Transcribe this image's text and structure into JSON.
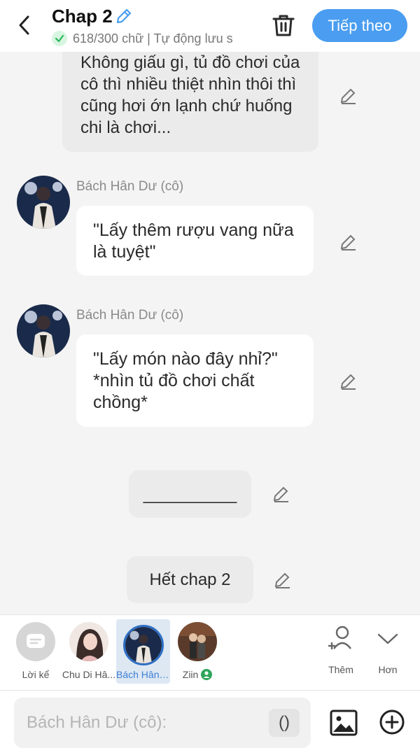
{
  "header": {
    "title": "Chap 2",
    "word_status": "618/300 chữ | Tự động lưu s",
    "next_label": "Tiếp theo",
    "accent_color": "#4a9df0"
  },
  "messages": [
    {
      "type": "narration",
      "text": "Không giấu gì, tủ đồ chơi của cô thì nhiều thiệt nhìn thôi thì cũng hơi ớn lạnh chứ huống chi là chơi..."
    },
    {
      "type": "dialogue",
      "speaker": "Bách Hân Dư (cô)",
      "text": "\"Lấy thêm rượu vang nữa là tuyệt\""
    },
    {
      "type": "dialogue",
      "speaker": "Bách Hân Dư (cô)",
      "text": "\"Lấy món nào đây nhỉ?\" *nhìn tủ đồ chơi chất chồng*"
    },
    {
      "type": "narration",
      "text": "__________"
    },
    {
      "type": "narration",
      "text": "Hết chap 2"
    }
  ],
  "characters": [
    {
      "name": "Lời kể",
      "icon": "message-icon"
    },
    {
      "name": "Chu Di Hâ...",
      "icon": "avatar"
    },
    {
      "name": "Bách Hân ...",
      "icon": "avatar",
      "selected": true
    },
    {
      "name": "Ziin",
      "icon": "avatar",
      "badge": "user-badge-icon"
    }
  ],
  "actions": {
    "add_label": "Thêm",
    "more_label": "Hơn"
  },
  "input": {
    "placeholder": "Bách Hân Dư (cô):",
    "paren_label": "()"
  }
}
